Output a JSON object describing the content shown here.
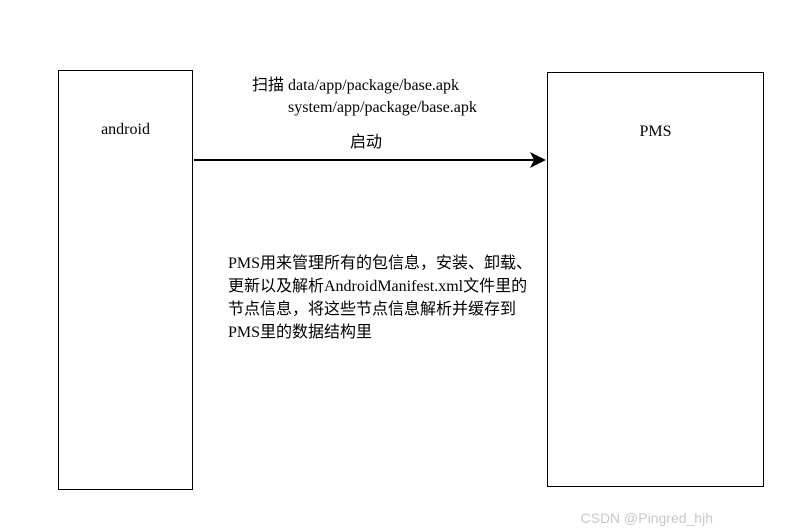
{
  "boxes": {
    "left_label": "android",
    "right_label": "PMS"
  },
  "scan": {
    "line1": "扫描 data/app/package/base.apk",
    "line2": "system/app/package/base.apk"
  },
  "arrow": {
    "label": "启动"
  },
  "description": "PMS用来管理所有的包信息，安装、卸载、更新以及解析AndroidManifest.xml文件里的节点信息，将这些节点信息解析并缓存到PMS里的数据结构里",
  "watermark": "CSDN @Pingred_hjh"
}
